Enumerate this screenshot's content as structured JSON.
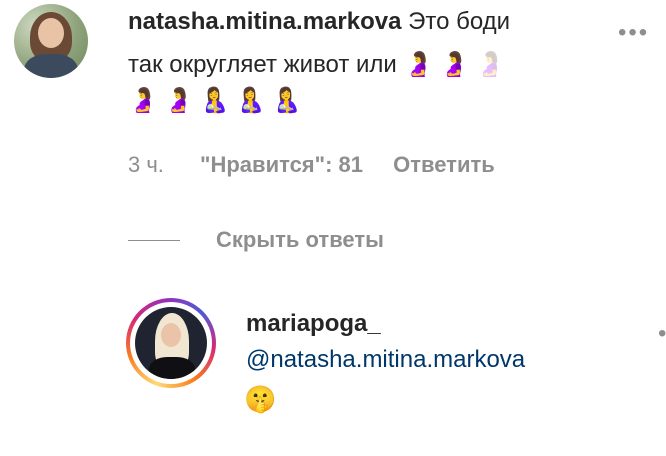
{
  "comment": {
    "username": "natasha.mitina.markova",
    "text_line1": "Это боди",
    "text_line2": "так округляет живот или",
    "emojis_line2": [
      "🤰",
      "🤰",
      "🤰"
    ],
    "emojis_line3": [
      "🤰",
      "🤰",
      "🤱",
      "🤱",
      "🤱"
    ],
    "more_dots": "•••",
    "meta": {
      "time": "3 ч.",
      "likes": "\"Нравится\": 81",
      "reply": "Ответить"
    }
  },
  "hide_replies": "Скрыть ответы",
  "reply_comment": {
    "username": "mariapoga_",
    "mention": "@natasha.mitina.markova",
    "emoji": "🤫",
    "more_dots": "•"
  }
}
